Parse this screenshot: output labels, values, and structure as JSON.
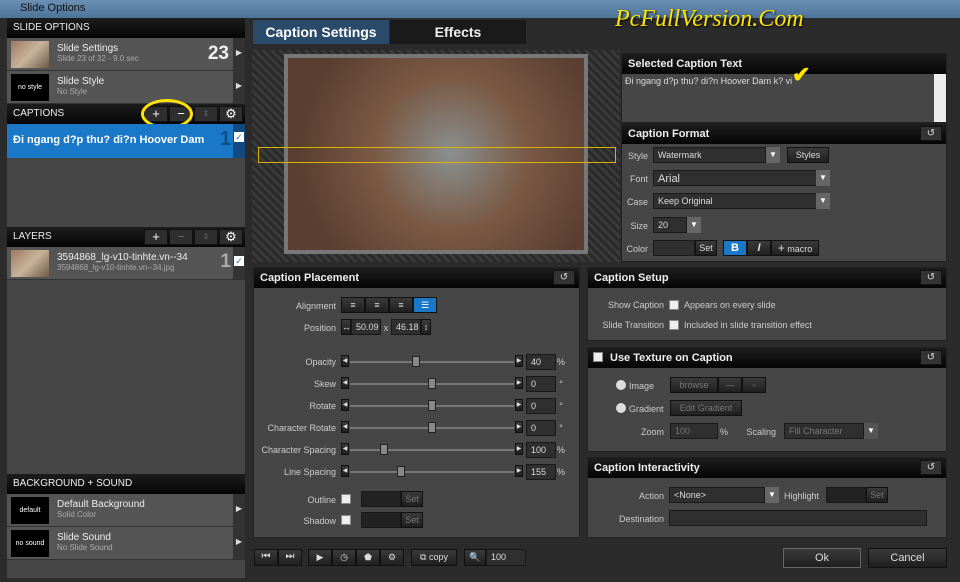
{
  "window": {
    "title": "Slide Options",
    "watermark": "PcFullVersion.Com"
  },
  "left": {
    "slide_options_header": "SLIDE OPTIONS",
    "slide_settings": {
      "title": "Slide Settings",
      "subtitle": "Slide 23 of 32 - 9.0 sec",
      "number": "23"
    },
    "slide_style": {
      "thumb": "no style",
      "title": "Slide Style",
      "subtitle": "No Style"
    },
    "captions_header": "CAPTIONS",
    "captions": [
      {
        "text": "Đi ngang d?p thu? di?n Hoover Dam",
        "number": "1",
        "checked": true
      }
    ],
    "layers_header": "LAYERS",
    "layers": [
      {
        "title": "3594868_lg-v10-tinhte.vn--34",
        "subtitle": "3594868_lg-v10-tinhte.vn--34.jpg",
        "number": "1",
        "checked": true
      }
    ],
    "bg_header": "BACKGROUND + SOUND",
    "background": {
      "thumb": "default",
      "title": "Default Background",
      "subtitle": "Solid Color"
    },
    "sound": {
      "thumb": "no sound",
      "title": "Slide Sound",
      "subtitle": "No Slide Sound"
    }
  },
  "tabs": [
    {
      "label": "Caption Settings",
      "active": true
    },
    {
      "label": "Effects",
      "active": false
    }
  ],
  "selected_caption": {
    "header": "Selected Caption Text",
    "text": "Đi ngang d?p thu? di?n Hoover Dam k? vi"
  },
  "format": {
    "header": "Caption Format",
    "style_label": "Style",
    "style": "Watermark",
    "styles_btn": "Styles",
    "font_label": "Font",
    "font": "Arial",
    "case_label": "Case",
    "case": "Keep Original",
    "size_label": "Size",
    "size": "20",
    "color_label": "Color",
    "set": "Set",
    "bold": "B",
    "italic": "I",
    "macro": "macro"
  },
  "placement": {
    "header": "Caption Placement",
    "alignment_label": "Alignment",
    "alignment_selected": "justify",
    "position_label": "Position",
    "pos_x": "50.09",
    "pos_sep": "x",
    "pos_y": "46.18",
    "sliders": [
      {
        "label": "Opacity",
        "value": "40",
        "unit": "%",
        "fraction": 0.4
      },
      {
        "label": "Skew",
        "value": "0",
        "unit": "°",
        "fraction": 0.5
      },
      {
        "label": "Rotate",
        "value": "0",
        "unit": "°",
        "fraction": 0.5
      },
      {
        "label": "Character Rotate",
        "value": "0",
        "unit": "°",
        "fraction": 0.5
      },
      {
        "label": "Character Spacing",
        "value": "100",
        "unit": "%",
        "fraction": 0.21
      },
      {
        "label": "Line Spacing",
        "value": "155",
        "unit": "%",
        "fraction": 0.31
      }
    ],
    "outline_label": "Outline",
    "shadow_label": "Shadow",
    "set": "Set"
  },
  "setup": {
    "header": "Caption Setup",
    "show_label": "Show Caption",
    "show_text": "Appears on every slide",
    "trans_label": "Slide Transition",
    "trans_text": "Included in slide transition effect"
  },
  "texture": {
    "header": "Use Texture on Caption",
    "image_label": "Image",
    "browse": "browse",
    "gradient_label": "Gradient",
    "edit_gradient": "Edit Gradient",
    "zoom_label": "Zoom",
    "zoom": "100",
    "zoom_unit": "%",
    "scaling_label": "Scaling",
    "scaling": "Fill Character"
  },
  "interactivity": {
    "header": "Caption Interactivity",
    "action_label": "Action",
    "action": "<None>",
    "highlight_label": "Highlight",
    "set": "Set",
    "destination_label": "Destination",
    "destination": ""
  },
  "toolbar": {
    "copy": "copy",
    "zoom": "100"
  },
  "buttons": {
    "ok": "Ok",
    "cancel": "Cancel"
  },
  "colors": {
    "accent": "#1a78c8",
    "check": "#ffe400"
  }
}
